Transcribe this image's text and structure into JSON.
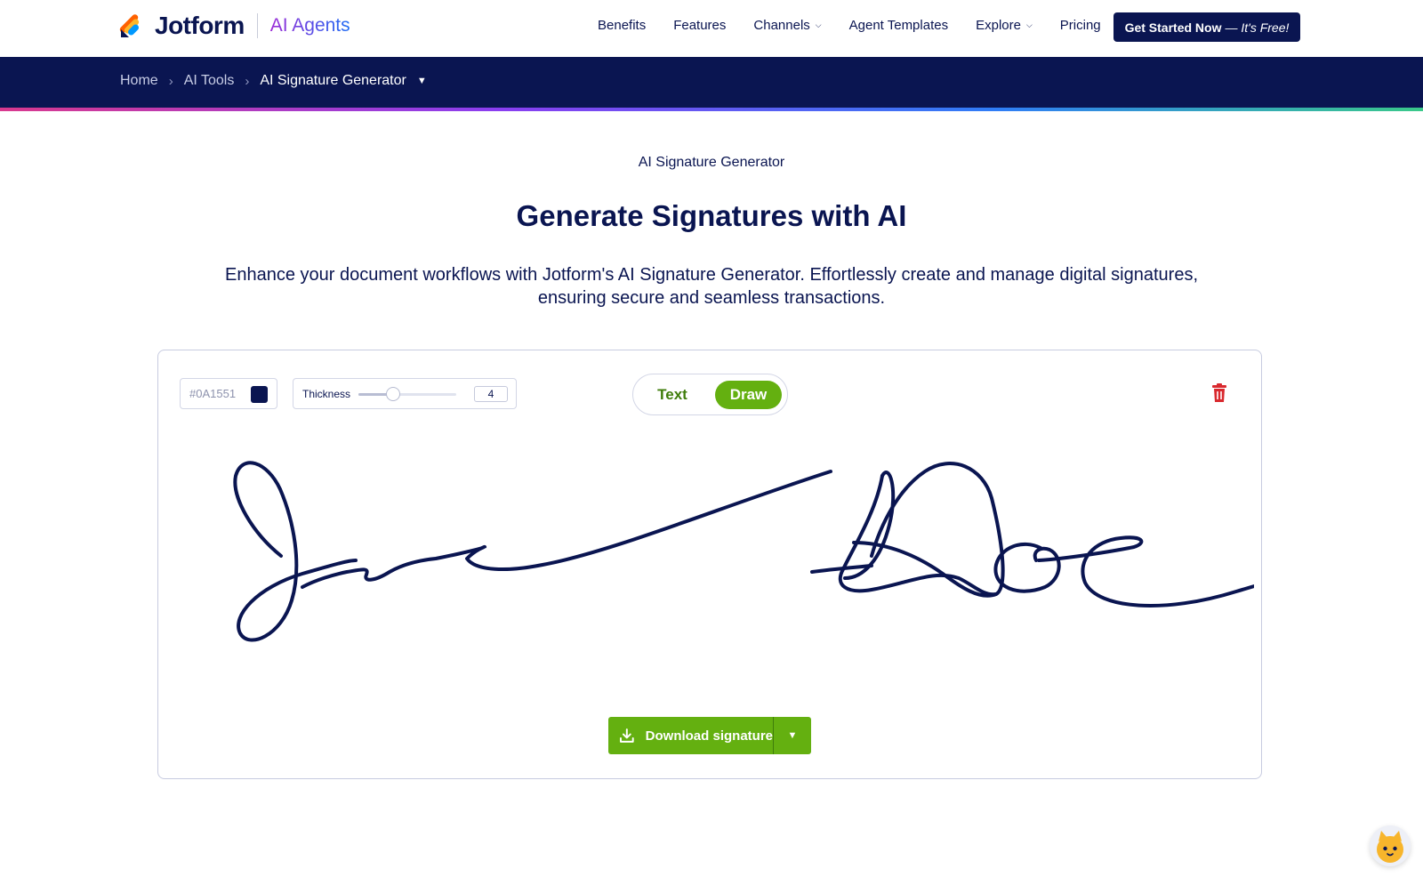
{
  "header": {
    "brand": "Jotform",
    "product": "AI Agents",
    "nav": [
      {
        "label": "Benefits",
        "dropdown": false
      },
      {
        "label": "Features",
        "dropdown": false
      },
      {
        "label": "Channels",
        "dropdown": true
      },
      {
        "label": "Agent Templates",
        "dropdown": false
      },
      {
        "label": "Explore",
        "dropdown": true
      },
      {
        "label": "Pricing",
        "dropdown": false
      }
    ],
    "cta_label": "Get Started Now",
    "cta_suffix": "— It's Free!"
  },
  "breadcrumb": {
    "items": [
      "Home",
      "AI Tools"
    ],
    "current": "AI Signature Generator"
  },
  "hero": {
    "eyebrow": "AI Signature Generator",
    "title": "Generate Signatures with AI",
    "subtitle": "Enhance your document workflows with Jotform's AI Signature Generator. Effortlessly create and manage digital signatures, ensuring secure and seamless transactions."
  },
  "editor": {
    "color_hex": "#0A1551",
    "thickness_label": "Thickness",
    "thickness_value": "4",
    "thickness_fraction": 0.35,
    "modes": {
      "text": "Text",
      "draw": "Draw"
    },
    "active_mode": "draw",
    "download_label": "Download signature"
  },
  "colors": {
    "navy": "#0A1551",
    "green": "#64B010",
    "danger": "#D9292E"
  }
}
